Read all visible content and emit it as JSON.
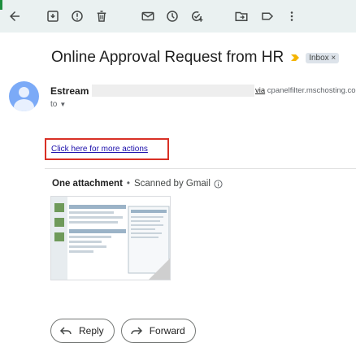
{
  "toolbar": {
    "icons": [
      "back-arrow-icon",
      "archive-icon",
      "report-spam-icon",
      "delete-icon",
      "mark-unread-icon",
      "snooze-icon",
      "add-to-tasks-icon",
      "move-to-icon",
      "label-icon",
      "more-options-icon"
    ]
  },
  "email": {
    "subject": "Online Approval Request from HR",
    "label_chip": "Inbox ×",
    "sender": {
      "name": "Estream",
      "via_prefix": "via",
      "via_domain": " cpanelfilter.mschosting.com",
      "to_label": "to"
    },
    "body_link": "Click here for more actions"
  },
  "attachments": {
    "title": "One attachment",
    "separator": "•",
    "scan_note": "Scanned by Gmail"
  },
  "actions": {
    "reply": "Reply",
    "forward": "Forward"
  },
  "colors": {
    "toolbar_bg": "#eaf1f1",
    "avatar": "#7baaf7",
    "highlight_box": "#d93025",
    "link": "#1a0dab",
    "important_marker": "#f4b400"
  }
}
